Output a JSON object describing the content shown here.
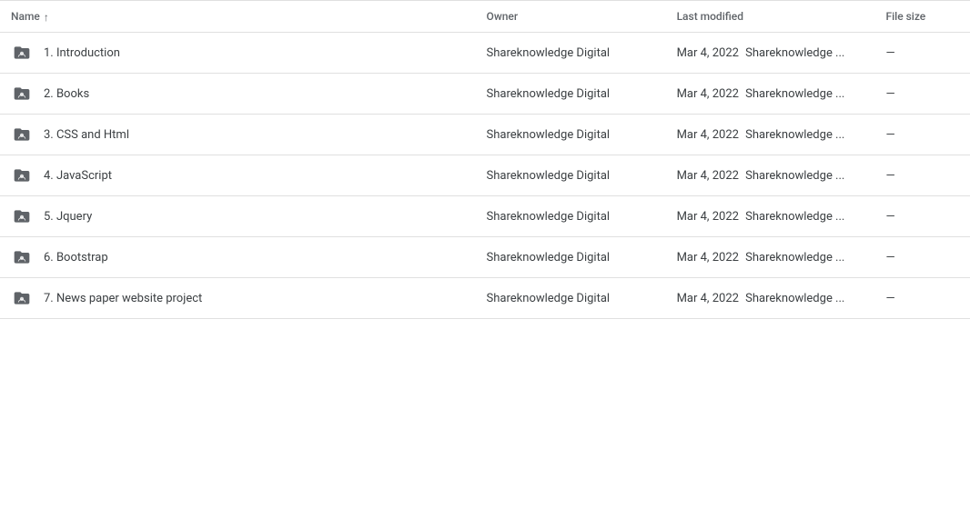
{
  "header": {
    "columns": {
      "name": "Name",
      "owner": "Owner",
      "last_modified": "Last modified",
      "file_size": "File size"
    },
    "sort_direction": "asc"
  },
  "rows": [
    {
      "id": 1,
      "name": "1. Introduction",
      "owner": "Shareknowledge Digital",
      "modified_date": "Mar 4, 2022",
      "modified_by": "Shareknowledge ...",
      "file_size": "—"
    },
    {
      "id": 2,
      "name": "2. Books",
      "owner": "Shareknowledge Digital",
      "modified_date": "Mar 4, 2022",
      "modified_by": "Shareknowledge ...",
      "file_size": "—"
    },
    {
      "id": 3,
      "name": "3. CSS and Html",
      "owner": "Shareknowledge Digital",
      "modified_date": "Mar 4, 2022",
      "modified_by": "Shareknowledge ...",
      "file_size": "—"
    },
    {
      "id": 4,
      "name": "4. JavaScript",
      "owner": "Shareknowledge Digital",
      "modified_date": "Mar 4, 2022",
      "modified_by": "Shareknowledge ...",
      "file_size": "—"
    },
    {
      "id": 5,
      "name": "5. Jquery",
      "owner": "Shareknowledge Digital",
      "modified_date": "Mar 4, 2022",
      "modified_by": "Shareknowledge ...",
      "file_size": "—"
    },
    {
      "id": 6,
      "name": "6. Bootstrap",
      "owner": "Shareknowledge Digital",
      "modified_date": "Mar 4, 2022",
      "modified_by": "Shareknowledge ...",
      "file_size": "—"
    },
    {
      "id": 7,
      "name": "7. News paper website project",
      "owner": "Shareknowledge Digital",
      "modified_date": "Mar 4, 2022",
      "modified_by": "Shareknowledge ...",
      "file_size": "—"
    }
  ],
  "icons": {
    "folder_color": "#5f6368",
    "sort_up": "↑"
  }
}
